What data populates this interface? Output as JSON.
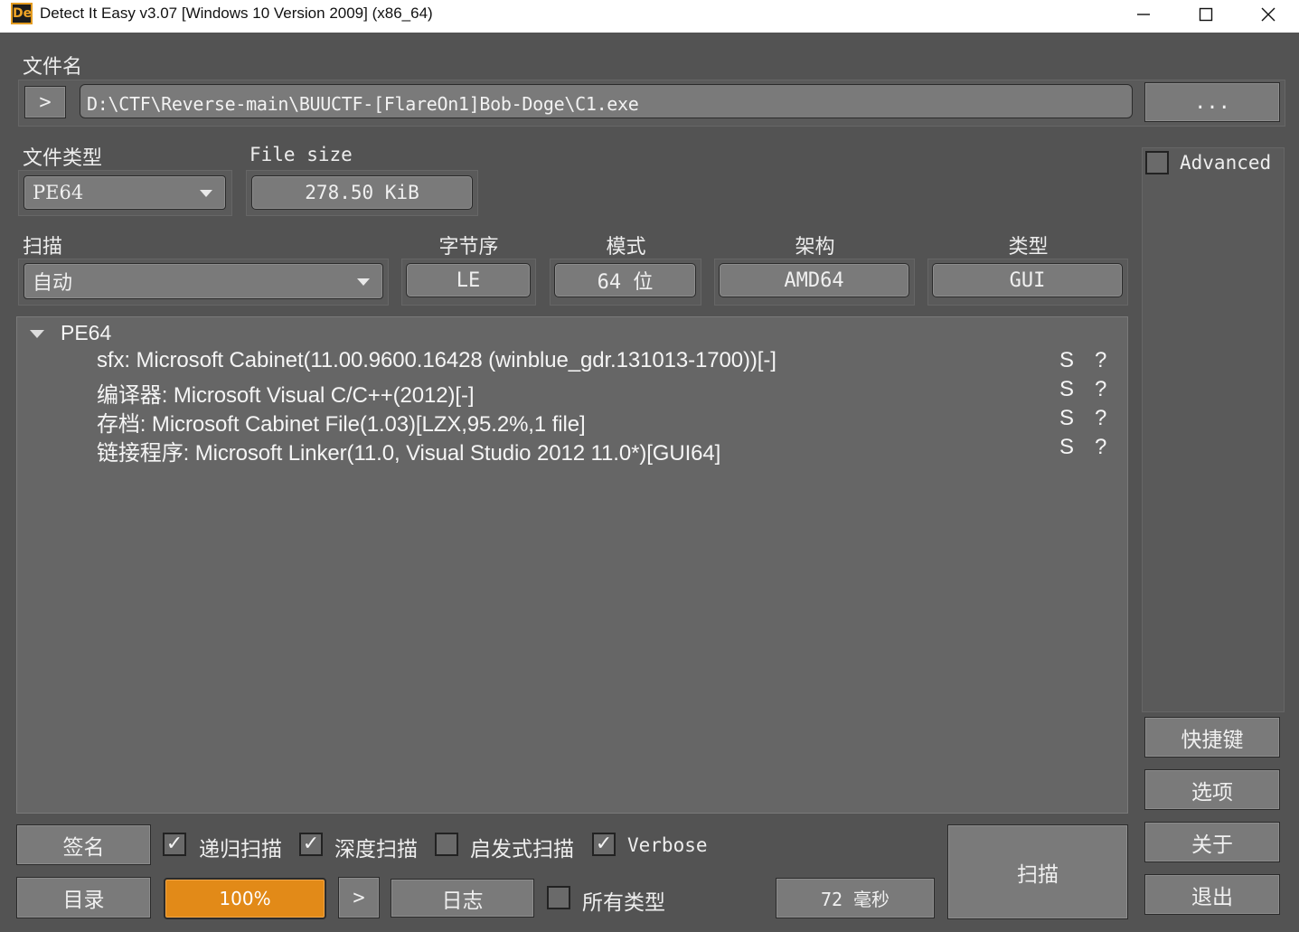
{
  "window": {
    "title": "Detect It Easy v3.07 [Windows 10 Version 2009] (x86_64)",
    "icon_text": "De",
    "controls": [
      "minimize-icon",
      "maximize-icon",
      "close-icon"
    ]
  },
  "file": {
    "label": "文件名",
    "expand_label": ">",
    "path": "D:\\CTF\\Reverse-main\\BUUCTF-[FlareOn1]Bob-Doge\\C1.exe",
    "browse_label": "..."
  },
  "file_type": {
    "label": "文件类型",
    "value": "PE64"
  },
  "file_size": {
    "label": "File size",
    "value": "278.50 KiB"
  },
  "scan": {
    "label": "扫描",
    "value": "自动"
  },
  "info": {
    "endianness": {
      "label": "字节序",
      "value": "LE"
    },
    "mode": {
      "label": "模式",
      "value": "64 位"
    },
    "arch": {
      "label": "架构",
      "value": "AMD64"
    },
    "type": {
      "label": "类型",
      "value": "GUI"
    }
  },
  "advanced": {
    "label": "Advanced",
    "checked": false
  },
  "results": {
    "root": "PE64",
    "rows": [
      {
        "text": "sfx: Microsoft Cabinet(11.00.9600.16428 (winblue_gdr.131013-1700))[-]",
        "s": "S",
        "q": "?"
      },
      {
        "text": "编译器: Microsoft Visual C/C++(2012)[-]",
        "s": "S",
        "q": "?"
      },
      {
        "text": "存档: Microsoft Cabinet File(1.03)[LZX,95.2%,1 file]",
        "s": "S",
        "q": "?"
      },
      {
        "text": "链接程序: Microsoft Linker(11.0, Visual Studio 2012 11.0*)[GUI64]",
        "s": "S",
        "q": "?"
      }
    ]
  },
  "side_buttons": {
    "shortcuts": "快捷键",
    "options": "选项",
    "about": "关于",
    "exit": "退出"
  },
  "bottom": {
    "signatures": "签名",
    "directory": "目录",
    "recursive": {
      "label": "递归扫描",
      "checked": true
    },
    "deep": {
      "label": "深度扫描",
      "checked": true
    },
    "heuristic": {
      "label": "启发式扫描",
      "checked": false
    },
    "verbose": {
      "label": "Verbose",
      "checked": true
    },
    "progress": "100%",
    "progress_fraction": 1.0,
    "next_label": ">",
    "log": "日志",
    "all_types": {
      "label": "所有类型",
      "checked": false
    },
    "elapsed": "72 毫秒",
    "scan_button": "扫描"
  },
  "colors": {
    "accent": "#e28a18",
    "background": "#535353",
    "panel": "#666666",
    "button": "#7a7a7a"
  }
}
